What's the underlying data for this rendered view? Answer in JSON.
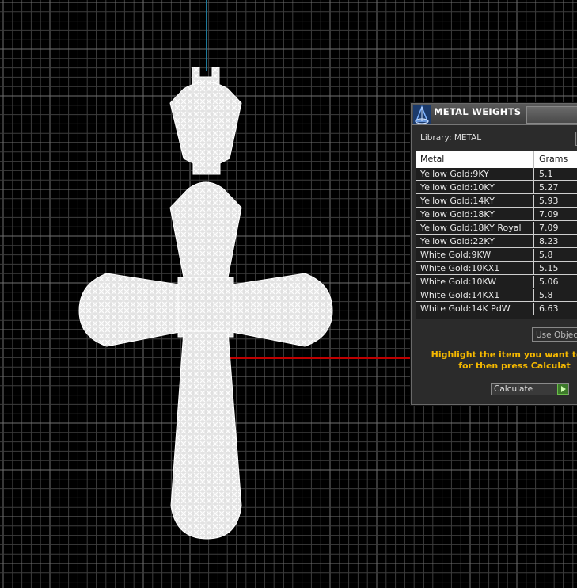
{
  "panel": {
    "title": "METAL WEIGHTS",
    "icon": "metal-weights-icon",
    "library_label": "Library: METAL",
    "columns": [
      "Metal",
      "Grams"
    ],
    "rows": [
      {
        "metal": "Yellow Gold:9KY",
        "grams": "5.1"
      },
      {
        "metal": "Yellow Gold:10KY",
        "grams": "5.27"
      },
      {
        "metal": "Yellow Gold:14KY",
        "grams": "5.93"
      },
      {
        "metal": "Yellow Gold:18KY",
        "grams": "7.09"
      },
      {
        "metal": "Yellow Gold:18KY Royal",
        "grams": "7.09"
      },
      {
        "metal": "Yellow Gold:22KY",
        "grams": "8.23"
      },
      {
        "metal": "White Gold:9KW",
        "grams": "5.8"
      },
      {
        "metal": "White Gold:10KX1",
        "grams": "5.15"
      },
      {
        "metal": "White Gold:10KW",
        "grams": "5.06"
      },
      {
        "metal": "White Gold:14KX1",
        "grams": "5.8"
      },
      {
        "metal": "White Gold:14K PdW",
        "grams": "6.63"
      }
    ],
    "use_object_label": "Use Objec",
    "instruction_line1": "Highlight the item you want to fin",
    "instruction_line2": "for then press Calculat",
    "calculate_label": "Calculate"
  },
  "colors": {
    "background": "#000000",
    "grid": "#5a5a5a",
    "wireframe": "#ffffff",
    "axis_x": "#c00000",
    "axis_z": "#1f7a9a",
    "instruction": "#f5b800"
  }
}
